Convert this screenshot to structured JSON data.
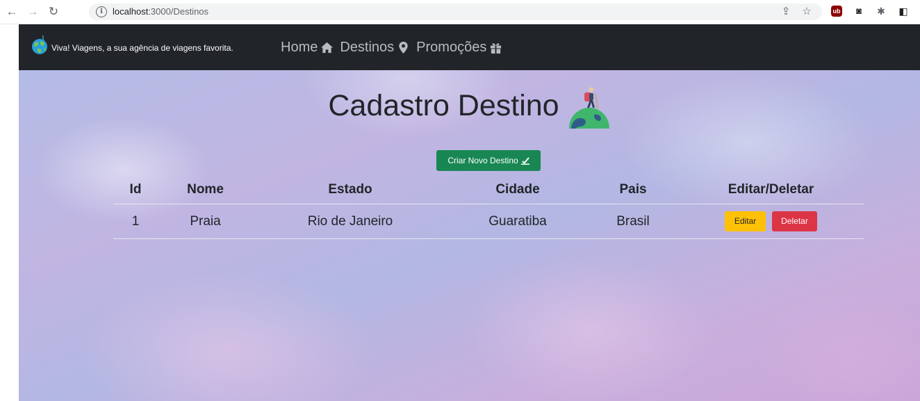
{
  "browser": {
    "url_host": "localhost",
    "url_rest": ":3000/Destinos"
  },
  "navbar": {
    "brand": "Viva! Viagens, a sua agência de viagens favorita.",
    "links": [
      {
        "label": "Home",
        "icon": "home-icon"
      },
      {
        "label": "Destinos",
        "icon": "map-marker-icon"
      },
      {
        "label": "Promoções",
        "icon": "gift-icon"
      }
    ]
  },
  "main": {
    "title": "Cadastro Destino",
    "new_button": "Criar Novo Destino"
  },
  "table": {
    "headers": [
      "Id",
      "Nome",
      "Estado",
      "Cidade",
      "Pais",
      "Editar/Deletar"
    ],
    "rows": [
      {
        "id": "1",
        "nome": "Praia",
        "estado": "Rio de Janeiro",
        "cidade": "Guaratiba",
        "pais": "Brasil",
        "edit_label": "Editar",
        "delete_label": "Deletar"
      }
    ]
  },
  "colors": {
    "navbar_bg": "#212529",
    "success": "#198754",
    "warning": "#ffc107",
    "danger": "#dc3545"
  }
}
